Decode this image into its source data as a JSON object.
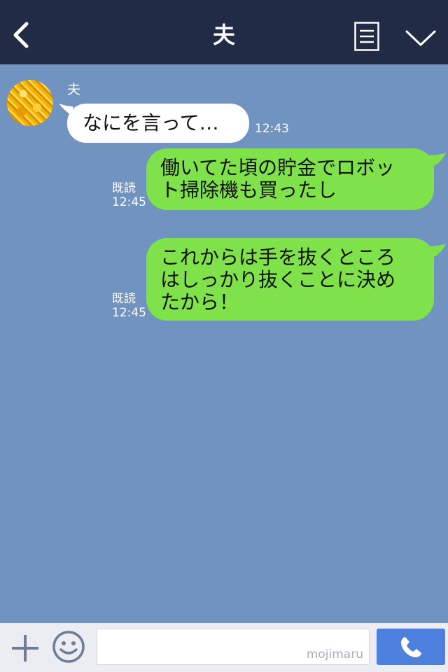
{
  "header": {
    "title": "夫"
  },
  "messages": [
    {
      "sender": "夫",
      "text": "なにを言って…",
      "time": "12:43"
    },
    {
      "read": "既読",
      "time": "12:45",
      "lines": [
        "働いてた頃の貯金でロボッ",
        "ト掃除機も買ったし"
      ]
    },
    {
      "read": "既読",
      "time": "12:45",
      "lines": [
        "これからは手を抜くところ",
        "はしっかり抜くことに決め",
        "たから！"
      ]
    }
  ],
  "footer": {
    "watermark": "mojimaru"
  },
  "colors": {
    "header": "#222b45",
    "chat_bg": "#7193c0",
    "outgoing": "#80e24a",
    "incoming": "#ffffff",
    "send": "#4d7fdc"
  }
}
